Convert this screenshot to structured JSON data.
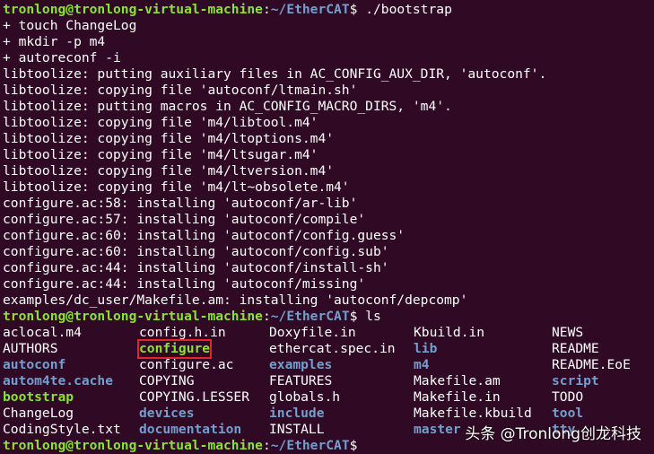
{
  "prompt": {
    "user_host": "tronlong@tronlong-virtual-machine",
    "sep": ":",
    "path": "~/EtherCAT",
    "symbol": "$"
  },
  "commands": [
    " ./bootstrap",
    " ls",
    ""
  ],
  "output_lines": [
    "+ touch ChangeLog",
    "+ mkdir -p m4",
    "+ autoreconf -i",
    "libtoolize: putting auxiliary files in AC_CONFIG_AUX_DIR, 'autoconf'.",
    "libtoolize: copying file 'autoconf/ltmain.sh'",
    "libtoolize: putting macros in AC_CONFIG_MACRO_DIRS, 'm4'.",
    "libtoolize: copying file 'm4/libtool.m4'",
    "libtoolize: copying file 'm4/ltoptions.m4'",
    "libtoolize: copying file 'm4/ltsugar.m4'",
    "libtoolize: copying file 'm4/ltversion.m4'",
    "libtoolize: copying file 'm4/lt~obsolete.m4'",
    "configure.ac:58: installing 'autoconf/ar-lib'",
    "configure.ac:57: installing 'autoconf/compile'",
    "configure.ac:60: installing 'autoconf/config.guess'",
    "configure.ac:60: installing 'autoconf/config.sub'",
    "configure.ac:44: installing 'autoconf/install-sh'",
    "configure.ac:44: installing 'autoconf/missing'",
    "examples/dc_user/Makefile.am: installing 'autoconf/depcomp'"
  ],
  "ls_rows": [
    [
      {
        "t": "aclocal.m4",
        "k": "file"
      },
      {
        "t": "config.h.in",
        "k": "file"
      },
      {
        "t": "Doxyfile.in",
        "k": "file"
      },
      {
        "t": "Kbuild.in",
        "k": "file"
      },
      {
        "t": "NEWS",
        "k": "file"
      }
    ],
    [
      {
        "t": "AUTHORS",
        "k": "file"
      },
      {
        "t": "configure",
        "k": "exec",
        "hl": true
      },
      {
        "t": "ethercat.spec.in",
        "k": "file"
      },
      {
        "t": "lib",
        "k": "dir"
      },
      {
        "t": "README",
        "k": "file"
      }
    ],
    [
      {
        "t": "autoconf",
        "k": "dir"
      },
      {
        "t": "configure.ac",
        "k": "file"
      },
      {
        "t": "examples",
        "k": "dir"
      },
      {
        "t": "m4",
        "k": "dir"
      },
      {
        "t": "README.EoE",
        "k": "file"
      }
    ],
    [
      {
        "t": "autom4te.cache",
        "k": "dir"
      },
      {
        "t": "COPYING",
        "k": "file"
      },
      {
        "t": "FEATURES",
        "k": "file"
      },
      {
        "t": "Makefile.am",
        "k": "file"
      },
      {
        "t": "script",
        "k": "dir"
      }
    ],
    [
      {
        "t": "bootstrap",
        "k": "exec"
      },
      {
        "t": "COPYING.LESSER",
        "k": "file"
      },
      {
        "t": "globals.h",
        "k": "file"
      },
      {
        "t": "Makefile.in",
        "k": "file"
      },
      {
        "t": "TODO",
        "k": "file"
      }
    ],
    [
      {
        "t": "ChangeLog",
        "k": "file"
      },
      {
        "t": "devices",
        "k": "dir"
      },
      {
        "t": "include",
        "k": "dir"
      },
      {
        "t": "Makefile.kbuild",
        "k": "file"
      },
      {
        "t": "tool",
        "k": "dir"
      }
    ],
    [
      {
        "t": "CodingStyle.txt",
        "k": "file"
      },
      {
        "t": "documentation",
        "k": "dir"
      },
      {
        "t": "INSTALL",
        "k": "file"
      },
      {
        "t": "master",
        "k": "dir"
      },
      {
        "t": "tty",
        "k": "dir"
      }
    ]
  ],
  "colors": {
    "background": "#300a24",
    "prompt_user": "#8ae234",
    "prompt_path": "#729fcf",
    "highlight_box": "#e0252b"
  },
  "watermark": "头条 @Tronlong创龙科技"
}
